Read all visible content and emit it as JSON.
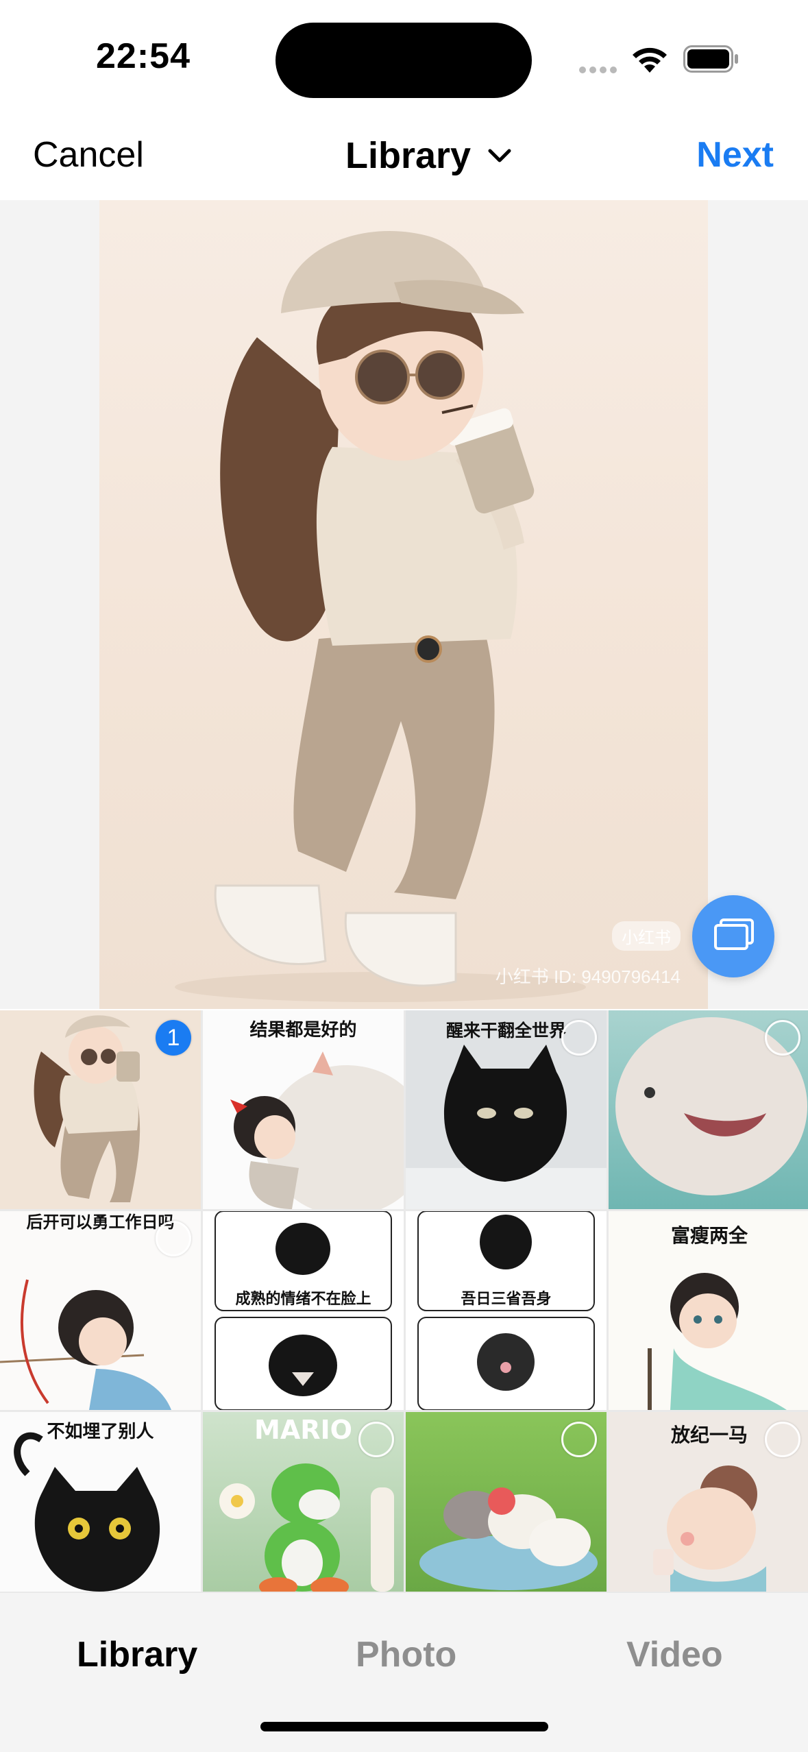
{
  "status_bar": {
    "time": "22:54"
  },
  "nav": {
    "cancel_label": "Cancel",
    "title": "Library",
    "next_label": "Next"
  },
  "preview": {
    "watermark_logo": "小红书",
    "watermark_id": "小红书 ID: 9490796414"
  },
  "grid": [
    {
      "caption": "",
      "selected": true,
      "selection_index": "1"
    },
    {
      "caption": "结果都是好的",
      "selected": false
    },
    {
      "caption": "醒来干翻全世界",
      "selected": false
    },
    {
      "caption": "",
      "selected": false
    },
    {
      "caption": "后开可以勇工作日吗",
      "selected": false
    },
    {
      "caption": "成熟的情绪不在脸上",
      "selected": false
    },
    {
      "caption": "吾日三省吾身",
      "selected": false
    },
    {
      "caption": "富瘦两全",
      "selected": false
    },
    {
      "caption": "不如埋了别人",
      "selected": false
    },
    {
      "caption": "MARIO",
      "selected": false
    },
    {
      "caption": "",
      "selected": false
    },
    {
      "caption": "放纪一马",
      "selected": false
    }
  ],
  "tabs": [
    {
      "label": "Library",
      "active": true
    },
    {
      "label": "Photo",
      "active": false
    },
    {
      "label": "Video",
      "active": false
    }
  ],
  "colors": {
    "accent": "#1a7cf2",
    "multi_select_button": "#4a98f5",
    "tab_inactive": "#8e8e8e"
  }
}
